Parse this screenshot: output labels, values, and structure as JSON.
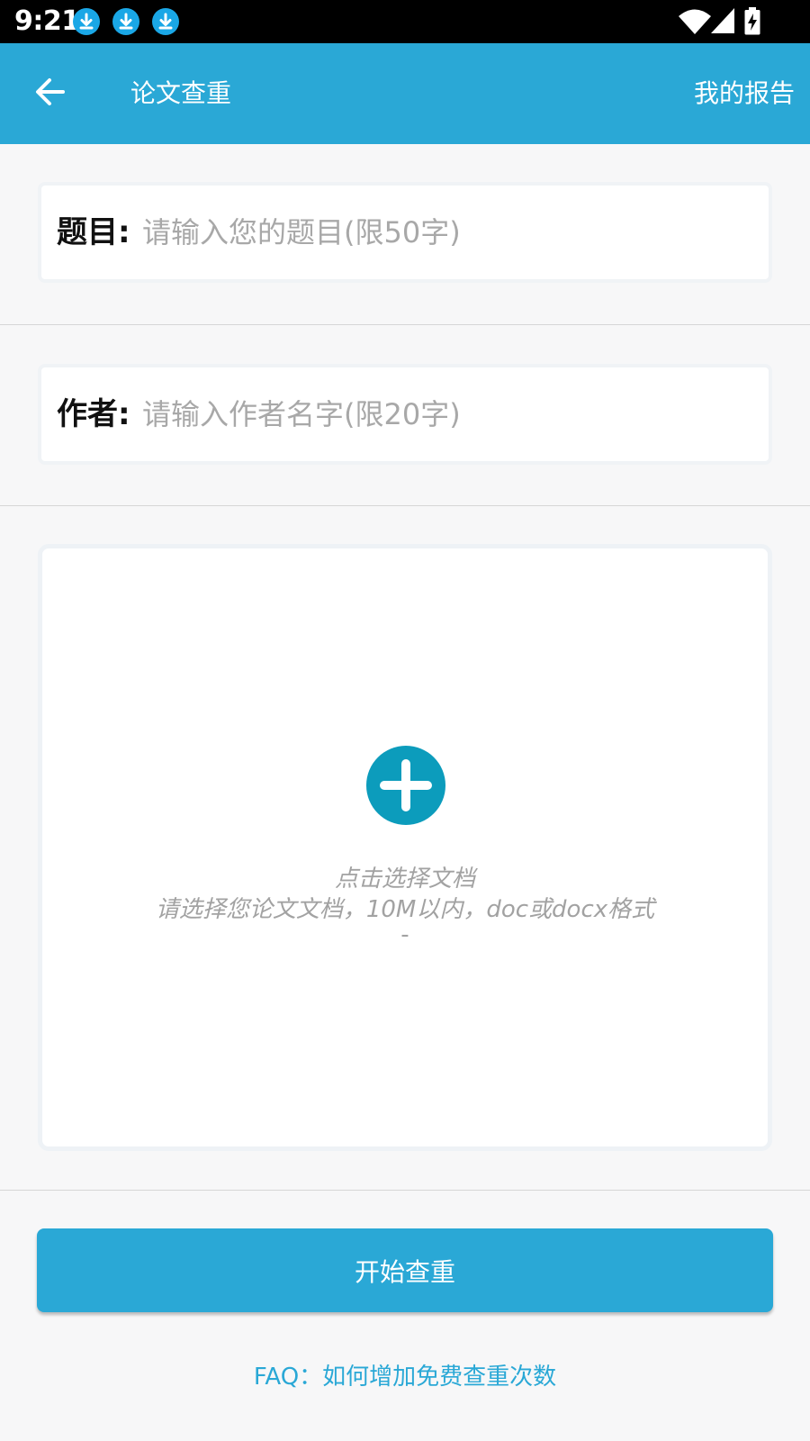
{
  "status_bar": {
    "time": "9:21",
    "notification_icons": [
      "download-icon",
      "download-icon",
      "download-icon"
    ],
    "system_icons": [
      "wifi-icon",
      "cellular-signal-icon",
      "battery-charging-icon"
    ]
  },
  "app_bar": {
    "back_icon": "arrow-left-icon",
    "title": "论文查重",
    "action_label": "我的报告"
  },
  "form": {
    "title_field": {
      "label": "题目:",
      "placeholder": "请输入您的题目(限50字)",
      "value": ""
    },
    "author_field": {
      "label": "作者:",
      "placeholder": "请输入作者名字(限20字)",
      "value": ""
    }
  },
  "upload": {
    "icon": "plus-circle-icon",
    "line1": "点击选择文档",
    "line2": "请选择您论文文档，10M以内，doc或docx格式",
    "line3": "-"
  },
  "start_button_label": "开始查重",
  "faq_label": "FAQ：如何增加免费查重次数",
  "colors": {
    "primary": "#2aa8d6",
    "plus_icon": "#0c9cbc",
    "placeholder": "#a8a8a8",
    "status_bar": "#000000",
    "download_badge": "#1aa7e6"
  }
}
